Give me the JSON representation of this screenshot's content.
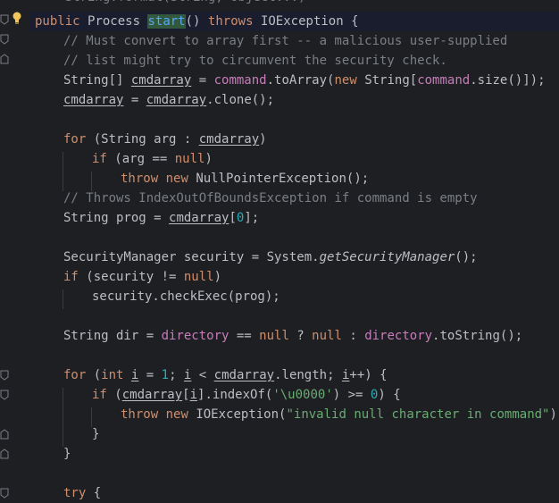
{
  "prev_line": "    String.format(String, Object...)",
  "code": {
    "l0_public": "public",
    "l0_class": "Process",
    "l0_method": "start",
    "l0_parens": "()",
    "l0_throws": "throws",
    "l0_exc": "IOException",
    "l0_brace": "{",
    "l1": "// Must convert to array first -- a malicious user-supplied",
    "l2": "// list might try to circumvent the security check.",
    "l3_a": "String[] ",
    "l3_var": "cmdarray",
    "l3_b": " = ",
    "l3_cmd": "command",
    "l3_c": ".toArray(",
    "l3_new": "new",
    "l3_d": " String[",
    "l3_cmd2": "command",
    "l3_e": ".size()]);",
    "l4_var": "cmdarray",
    "l4_a": " = ",
    "l4_var2": "cmdarray",
    "l4_b": ".clone();",
    "l5_for": "for",
    "l5_a": " (String arg : ",
    "l5_var": "cmdarray",
    "l5_b": ")",
    "l6_if": "if",
    "l6_a": " (arg == ",
    "l6_null": "null",
    "l6_b": ")",
    "l7_throw": "throw",
    "l7_new": "new",
    "l7_a": " NullPointerException();",
    "l8": "// Throws IndexOutOfBoundsException if command is empty",
    "l9_a": "String prog = ",
    "l9_var": "cmdarray",
    "l9_b": "[",
    "l9_num": "0",
    "l9_c": "];",
    "l10_a": "SecurityManager security = System.",
    "l10_m": "getSecurityManager",
    "l10_b": "();",
    "l11_if": "if",
    "l11_a": " (security != ",
    "l11_null": "null",
    "l11_b": ")",
    "l12": "security.checkExec(prog);",
    "l13_a": "String dir = ",
    "l13_dir": "directory",
    "l13_b": " == ",
    "l13_null": "null",
    "l13_c": " ? ",
    "l13_null2": "null",
    "l13_d": " : ",
    "l13_dir2": "directory",
    "l13_e": ".toString();",
    "l14_for": "for",
    "l14_a": " (",
    "l14_int": "int",
    "l14_i": "i",
    "l14_b": " = ",
    "l14_one": "1",
    "l14_c": "; ",
    "l14_i2": "i",
    "l14_d": " < ",
    "l14_var": "cmdarray",
    "l14_e": ".length; ",
    "l14_i3": "i",
    "l14_f": "++) {",
    "l15_if": "if",
    "l15_a": " (",
    "l15_var": "cmdarray",
    "l15_b": "[",
    "l15_i": "i",
    "l15_c": "].indexOf(",
    "l15_str": "'\\u0000'",
    "l15_d": ") >= ",
    "l15_num": "0",
    "l15_e": ") {",
    "l16_throw": "throw",
    "l16_new": "new",
    "l16_a": " IOException(",
    "l16_str": "\"invalid null character in command\"",
    "l16_b": ");",
    "l17": "}",
    "l18": "}",
    "l19_try": "try",
    "l19_a": " {"
  },
  "colors": {
    "keyword": "#cf8e6d",
    "comment": "#7a7e85",
    "method": "#56a8f5",
    "field": "#c77dbb",
    "number": "#2aacb8",
    "string": "#6aab73",
    "text": "#bcbec4",
    "background": "#1e1f22"
  },
  "icons": [
    "intention-bulb-icon",
    "fold-marker-icon"
  ]
}
